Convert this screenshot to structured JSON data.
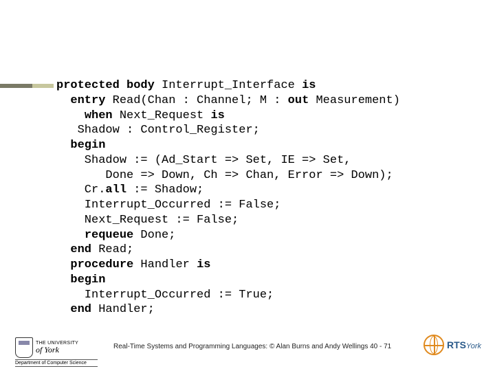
{
  "code": {
    "l1a": "protected body",
    "l1b": " Interrupt_Interface ",
    "l1c": "is",
    "l2a": "  ",
    "l2b": "entry",
    "l2c": " Read(Chan : Channel; M : ",
    "l2d": "out",
    "l2e": " Measurement)",
    "l3a": "    ",
    "l3b": "when",
    "l3c": " Next_Request ",
    "l3d": "is",
    "l4": "   Shadow : Control_Register;",
    "l5": "  ",
    "l5b": "begin",
    "l6": "    Shadow := (Ad_Start => Set, IE => Set,",
    "l7": "       Done => Down, Ch => Chan, Error => Down);",
    "l8a": "    Cr.",
    "l8b": "all",
    "l8c": " := Shadow;",
    "l9": "    Interrupt_Occurred := False;",
    "l10": "    Next_Request := False;",
    "l11a": "    ",
    "l11b": "requeue",
    "l11c": " Done;",
    "l12a": "  ",
    "l12b": "end",
    "l12c": " Read;",
    "l13a": "  ",
    "l13b": "procedure",
    "l13c": " Handler ",
    "l13d": "is",
    "l14a": "  ",
    "l14b": "begin",
    "l15": "    Interrupt_Occurred := True;",
    "l16a": "  ",
    "l16b": "end",
    "l16c": " Handler;"
  },
  "footer": "Real-Time Systems and Programming Languages: © Alan Burns and Andy Wellings  40 - 71",
  "uni": {
    "line1": "THE UNIVERSITY",
    "line2": "of York",
    "dept": "Department of Computer Science"
  },
  "rts": {
    "main": "RTS",
    "sub": "York"
  }
}
